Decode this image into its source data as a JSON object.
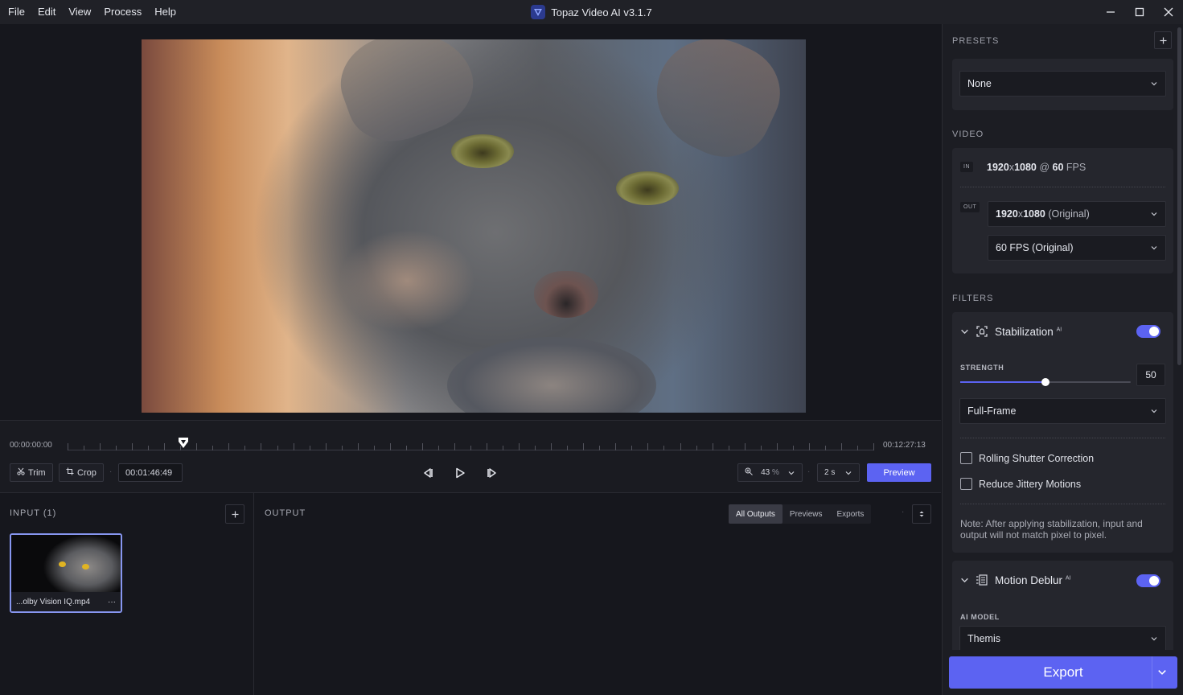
{
  "window": {
    "title": "Topaz Video AI  v3.1.7",
    "menu": [
      "File",
      "Edit",
      "View",
      "Process",
      "Help"
    ]
  },
  "timeline": {
    "start_time": "00:00:00:00",
    "end_time": "00:12:27:13",
    "playhead_fraction": 0.143,
    "trim_label": "Trim",
    "crop_label": "Crop",
    "current_time": "00:01:46:49",
    "zoom_value": "43",
    "zoom_unit": "%",
    "preview_duration": "2 s",
    "preview_label": "Preview"
  },
  "input": {
    "title": "INPUT (1)",
    "file_name": "...olby Vision IQ.mp4",
    "more_label": "···"
  },
  "output": {
    "title": "OUTPUT",
    "tabs": [
      "All Outputs",
      "Previews",
      "Exports"
    ],
    "active_tab": "All Outputs"
  },
  "sidebar": {
    "presets_title": "PRESETS",
    "preset_value": "None",
    "video_title": "VIDEO",
    "in_tag": "IN",
    "out_tag": "OUT",
    "in_res": "1920",
    "in_x": "x",
    "in_res2": "1080",
    "in_at": " @ ",
    "in_fps": "60",
    "in_fps_unit": " FPS",
    "out_res_bold": "1920",
    "out_res_x": "x",
    "out_res_bold2": "1080",
    "out_res_suffix": " (Original)",
    "out_fps": "60 FPS (Original)",
    "filters_title": "FILTERS",
    "stabilization": {
      "name": "Stabilization",
      "ai": "AI",
      "enabled": true,
      "strength_label": "STRENGTH",
      "strength": 50,
      "strength_max": 100,
      "mode": "Full-Frame",
      "rolling_shutter": "Rolling Shutter Correction",
      "rolling_checked": false,
      "jittery": "Reduce Jittery Motions",
      "jittery_checked": false,
      "note": "Note: After applying stabilization, input and output will not match pixel to pixel."
    },
    "motion_deblur": {
      "name": "Motion Deblur",
      "ai": "AI",
      "enabled": true,
      "model_label": "AI MODEL",
      "model": "Themis"
    },
    "export_label": "Export"
  },
  "icons": {
    "app_logo": "topaz-logo-icon",
    "minimize": "minimize-icon",
    "maximize": "maximize-icon",
    "close": "close-icon",
    "trim": "scissors-icon",
    "crop": "crop-icon",
    "prev_frame": "step-back-icon",
    "play": "play-icon",
    "next_frame": "step-forward-icon",
    "zoom": "zoom-icon",
    "add": "plus-icon",
    "sort": "sort-icon",
    "stabilization": "stabilization-icon",
    "motion_deblur": "motion-deblur-icon",
    "chevron": "chevron-down-icon"
  },
  "colors": {
    "accent": "#5c63f2",
    "background": "#16171d",
    "sidebar": "#1c1d23",
    "card": "#25262d"
  }
}
